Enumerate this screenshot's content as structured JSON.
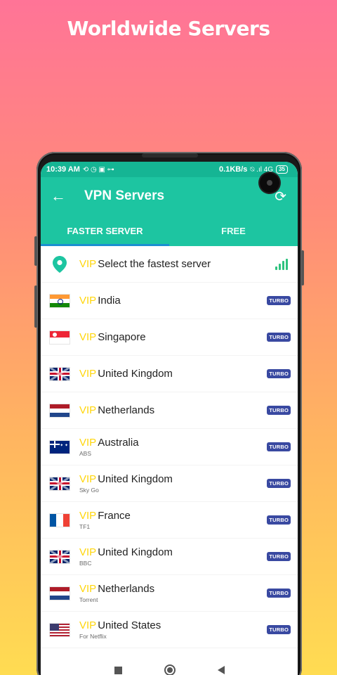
{
  "promo": {
    "title": "Worldwide Servers"
  },
  "status_bar": {
    "time": "10:39 AM",
    "left_icons": "⟲ ◷ ▣ ⊶",
    "network_speed": "0.1KB/s",
    "right_icons": "⍉ .ıl 4G",
    "battery": "35"
  },
  "app_bar": {
    "title": "VPN Servers",
    "back_icon": "←",
    "refresh_icon": "⟳"
  },
  "tabs": [
    {
      "label": "FASTER SERVER",
      "active": true
    },
    {
      "label": "FREE",
      "active": false
    }
  ],
  "vip_label": "VIP",
  "fastest": {
    "label": "Select the fastest server"
  },
  "turbo_label": "TURBO",
  "servers": [
    {
      "flag": "in",
      "name": "India",
      "sub": ""
    },
    {
      "flag": "sg",
      "name": "Singapore",
      "sub": ""
    },
    {
      "flag": "gb",
      "name": "United Kingdom",
      "sub": ""
    },
    {
      "flag": "nl",
      "name": "Netherlands",
      "sub": ""
    },
    {
      "flag": "au",
      "name": "Australia",
      "sub": "ABS"
    },
    {
      "flag": "gb",
      "name": "United Kingdom",
      "sub": "Sky Go"
    },
    {
      "flag": "fr",
      "name": "France",
      "sub": "TF1"
    },
    {
      "flag": "gb",
      "name": "United Kingdom",
      "sub": "BBC"
    },
    {
      "flag": "nl",
      "name": "Netherlands",
      "sub": "Torrent"
    },
    {
      "flag": "us",
      "name": "United States",
      "sub": "For Netflix"
    }
  ],
  "colors": {
    "accent": "#1dc5a1",
    "vip": "#ffd60a",
    "turbo": "#3949a1",
    "tab_indicator": "#1a8fd1"
  }
}
